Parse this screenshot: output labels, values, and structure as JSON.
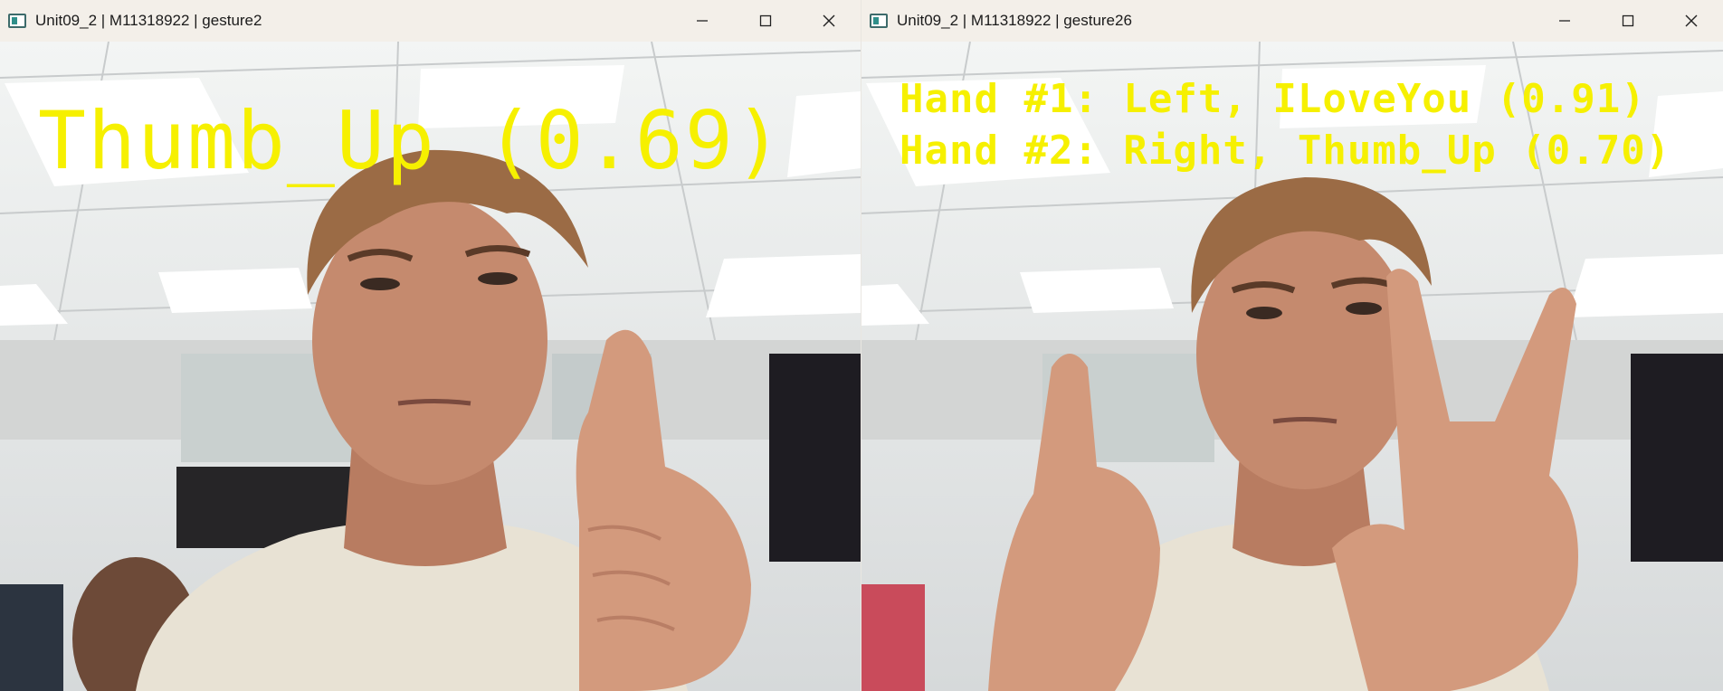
{
  "windows": [
    {
      "title": "Unit09_2 | M11318922 | gesture2",
      "controls": {
        "minimize": "minimize",
        "maximize": "maximize",
        "close": "close"
      },
      "overlay": {
        "label": "Thumb_Up (0.69)"
      }
    },
    {
      "title": "Unit09_2 | M11318922 | gesture26",
      "controls": {
        "minimize": "minimize",
        "maximize": "maximize",
        "close": "close"
      },
      "overlay": {
        "line1": "Hand #1: Left, ILoveYou (0.91)",
        "line2": "Hand #2: Right, Thumb_Up (0.70)"
      }
    }
  ],
  "colors": {
    "overlay_text": "#f6f000",
    "titlebar": "#f3efe9",
    "ceiling": "#eef0ef",
    "shirt": "#e8e2d4",
    "skin": "#c58a6e",
    "hair": "#9b6b45"
  },
  "icons": [
    "app-icon",
    "minimize-icon",
    "maximize-icon",
    "close-icon"
  ]
}
